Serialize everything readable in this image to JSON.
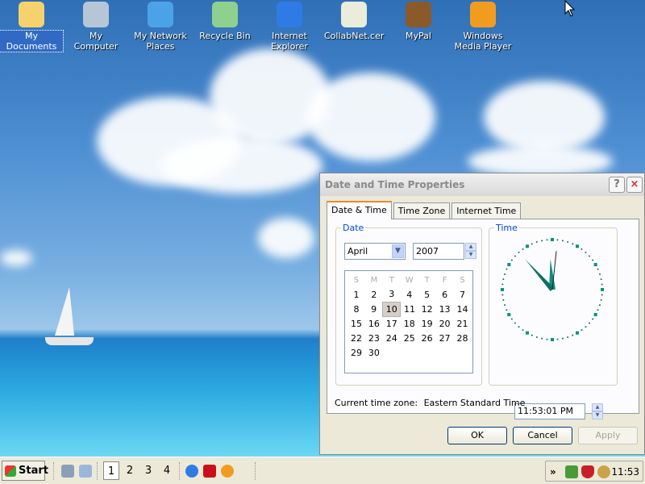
{
  "desktop": {
    "icons": [
      {
        "label": "My Documents",
        "name": "my-documents-icon",
        "color": "#f5d26b"
      },
      {
        "label": "My Computer",
        "name": "my-computer-icon",
        "color": "#b6c6d6"
      },
      {
        "label": "My Network Places",
        "name": "my-network-places-icon",
        "color": "#4aa3e8"
      },
      {
        "label": "Recycle Bin",
        "name": "recycle-bin-icon",
        "color": "#8fd08f"
      },
      {
        "label": "Internet Explorer",
        "name": "internet-explorer-icon",
        "color": "#2e7be6"
      },
      {
        "label": "CollabNet.cer",
        "name": "certificate-icon",
        "color": "#e9edd9"
      },
      {
        "label": "MyPal",
        "name": "mypal-icon",
        "color": "#8a5a2a"
      },
      {
        "label": "Windows Media Player",
        "name": "windows-media-player-icon",
        "color": "#f29c1f"
      }
    ]
  },
  "dialog": {
    "title": "Date and Time Properties",
    "help_label": "?",
    "close_label": "×",
    "tabs": [
      "Date & Time",
      "Time Zone",
      "Internet Time"
    ],
    "date_group_label": "Date",
    "time_group_label": "Time",
    "month": "April",
    "year": "2007",
    "weekday_headers": [
      "S",
      "M",
      "T",
      "W",
      "T",
      "F",
      "S"
    ],
    "calendar_rows": [
      [
        "1",
        "2",
        "3",
        "4",
        "5",
        "6",
        "7"
      ],
      [
        "8",
        "9",
        "10",
        "11",
        "12",
        "13",
        "14"
      ],
      [
        "15",
        "16",
        "17",
        "18",
        "19",
        "20",
        "21"
      ],
      [
        "22",
        "23",
        "24",
        "25",
        "26",
        "27",
        "28"
      ],
      [
        "29",
        "30",
        "",
        "",
        "",
        "",
        ""
      ]
    ],
    "selected_day": "10",
    "time_value": "11:53:01 PM",
    "clock": {
      "hour": 11,
      "minute": 53,
      "second": 1
    },
    "timezone_label": "Current time zone:",
    "timezone_value": "Eastern Standard Time",
    "ok_label": "OK",
    "cancel_label": "Cancel",
    "apply_label": "Apply"
  },
  "taskbar": {
    "start_label": "Start",
    "workspaces": [
      "1",
      "2",
      "3",
      "4"
    ],
    "active_workspace": "1",
    "tray_chevron": "»",
    "clock": "11:53"
  }
}
